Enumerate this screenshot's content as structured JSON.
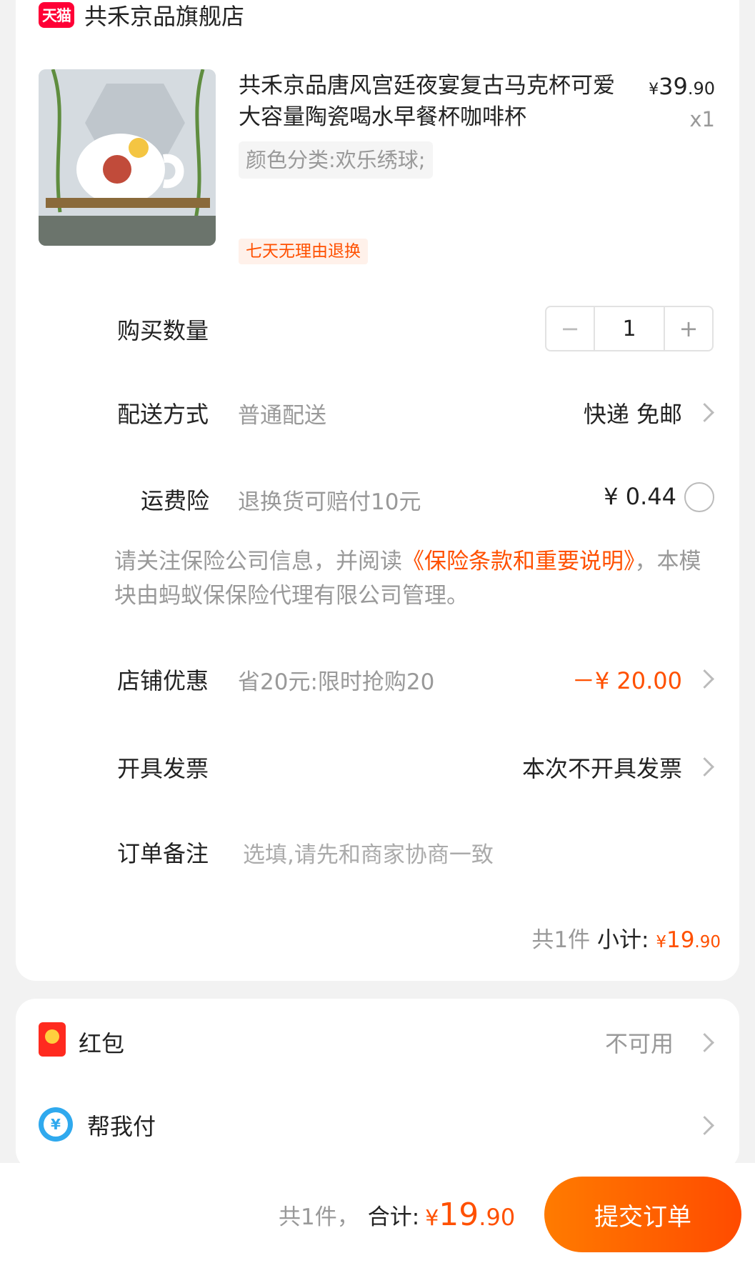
{
  "store": {
    "badge": "天猫",
    "name": "共禾京品旗舰店"
  },
  "product": {
    "title": "共禾京品唐风宫廷夜宴复古马克杯可爱大容量陶瓷喝水早餐杯咖啡杯",
    "price_yen": "¥",
    "price_int": "39",
    "price_dec": ".90",
    "qty_text": "x1",
    "sku": "颜色分类:欢乐绣球;",
    "return_tag": "七天无理由退换"
  },
  "quantity": {
    "label": "购买数量",
    "minus": "−",
    "value": "1",
    "plus": "+"
  },
  "delivery": {
    "label": "配送方式",
    "sub": "普通配送",
    "value": "快递 免邮"
  },
  "insurance": {
    "label": "运费险",
    "sub": "退换货可赔付10元",
    "value": "¥ 0.44"
  },
  "notice": {
    "prefix": "请关注保险公司信息，并阅读",
    "link": "《保险条款和重要说明》",
    "suffix": "，本模块由蚂蚁保保险代理有限公司管理。"
  },
  "store_discount": {
    "label": "店铺优惠",
    "sub": "省20元:限时抢购20",
    "value": "－¥ 20.00"
  },
  "invoice": {
    "label": "开具发票",
    "value": "本次不开具发票"
  },
  "remark": {
    "label": "订单备注",
    "placeholder": "选填,请先和商家协商一致"
  },
  "subtotal": {
    "count": "共1件",
    "label": "小计:",
    "yen": "¥",
    "int": "19",
    "dec": ".90"
  },
  "red_packet": {
    "label": "红包",
    "value": "不可用"
  },
  "help_pay": {
    "label": "帮我付",
    "icon_char": "¥"
  },
  "footer": {
    "count": "共1件，",
    "label": "合计:",
    "yen": "¥",
    "int": "19",
    "dec": ".90",
    "submit": "提交订单"
  },
  "colors": {
    "accent": "#ff5000",
    "tmall_red": "#ff0036"
  }
}
